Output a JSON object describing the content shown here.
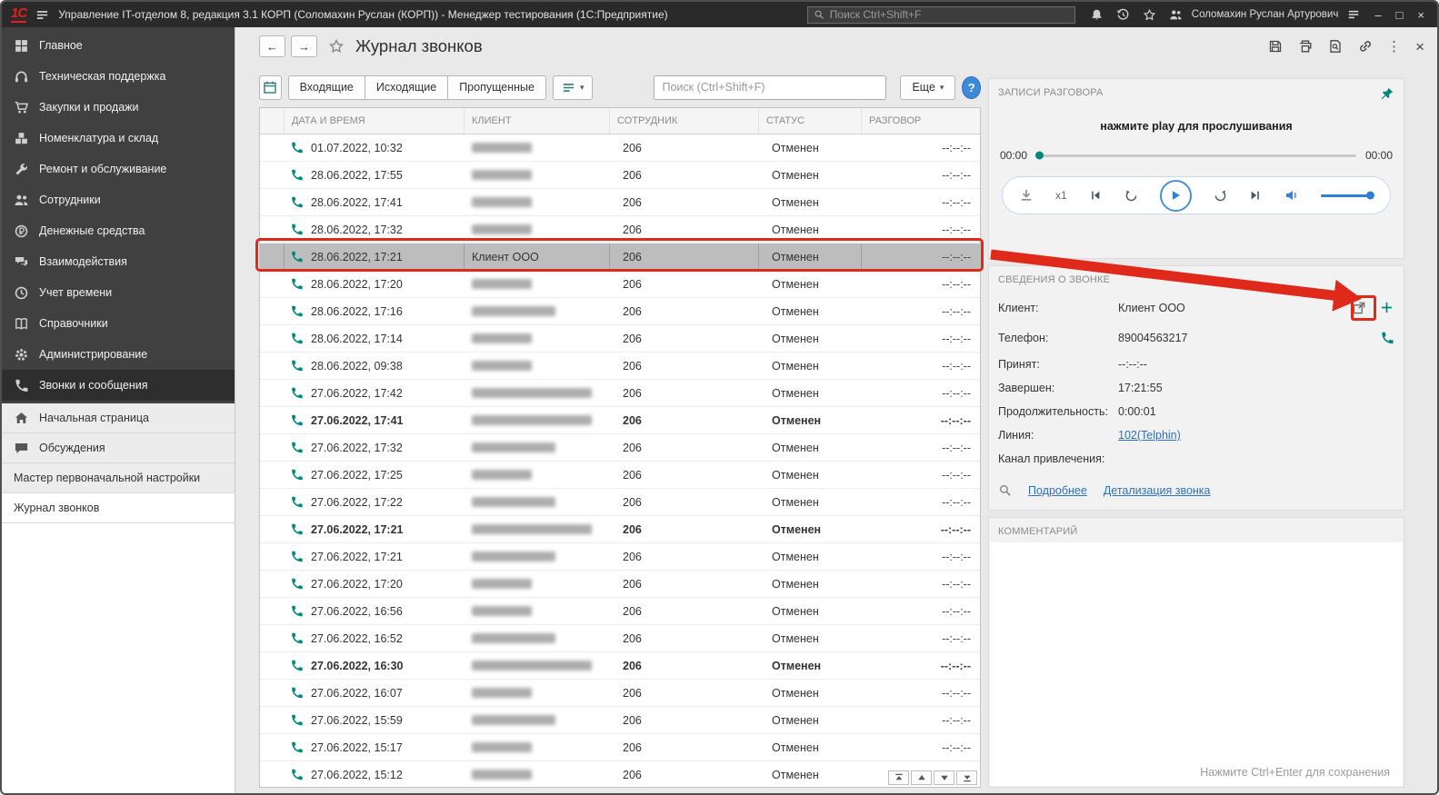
{
  "topbar": {
    "logo": "1С",
    "title": "Управление IT-отделом 8, редакция 3.1 КОРП (Соломахин Руслан (КОРП))  - Менеджер тестирования (1С:Предприятие)",
    "search_placeholder": "Поиск Ctrl+Shift+F",
    "user": "Соломахин Руслан Артурович",
    "window_controls": {
      "minimize": "–",
      "maximize": "□",
      "close": "×"
    }
  },
  "sidebar": {
    "main_items": [
      {
        "label": "Главное",
        "icon": "grid"
      },
      {
        "label": "Техническая поддержка",
        "icon": "headset"
      },
      {
        "label": "Закупки и продажи",
        "icon": "cart"
      },
      {
        "label": "Номенклатура и склад",
        "icon": "boxes"
      },
      {
        "label": "Ремонт и обслуживание",
        "icon": "wrench"
      },
      {
        "label": "Сотрудники",
        "icon": "users"
      },
      {
        "label": "Денежные средства",
        "icon": "money"
      },
      {
        "label": "Взаимодействия",
        "icon": "interact"
      },
      {
        "label": "Учет времени",
        "icon": "clock"
      },
      {
        "label": "Справочники",
        "icon": "book"
      },
      {
        "label": "Администрирование",
        "icon": "gear"
      },
      {
        "label": "Звонки и сообщения",
        "icon": "phone",
        "active": true
      }
    ],
    "bottom_items": [
      {
        "label": "Начальная страница",
        "icon": "home"
      },
      {
        "label": "Обсуждения",
        "icon": "chat"
      },
      {
        "label": "Мастер первоначальной настройки"
      },
      {
        "label": "Журнал звонков",
        "active": true
      }
    ]
  },
  "page": {
    "title": "Журнал звонков"
  },
  "toolbar": {
    "filters": [
      {
        "label": "Входящие"
      },
      {
        "label": "Исходящие"
      },
      {
        "label": "Пропущенные"
      }
    ],
    "search_placeholder": "Поиск (Ctrl+Shift+F)",
    "more_label": "Еще",
    "help_label": "?"
  },
  "table": {
    "columns": [
      "",
      "ДАТА И ВРЕМЯ",
      "КЛИЕНТ",
      "СОТРУДНИК",
      "СТАТУС",
      "РАЗГОВОР"
    ],
    "rows": [
      {
        "dt": "01.07.2022, 10:32",
        "emp": "206",
        "status": "Отменен",
        "talk": "--:--:--",
        "cw": 66
      },
      {
        "dt": "28.06.2022, 17:55",
        "emp": "206",
        "status": "Отменен",
        "talk": "--:--:--",
        "cw": 66
      },
      {
        "dt": "28.06.2022, 17:41",
        "emp": "206",
        "status": "Отменен",
        "talk": "--:--:--",
        "cw": 66
      },
      {
        "dt": "28.06.2022, 17:32",
        "emp": "206",
        "status": "Отменен",
        "talk": "--:--:--",
        "cw": 66
      },
      {
        "dt": "28.06.2022, 17:21",
        "client": "Клиент ООО",
        "emp": "206",
        "status": "Отменен",
        "talk": "--:--:--",
        "selected": true
      },
      {
        "dt": "28.06.2022, 17:20",
        "emp": "206",
        "status": "Отменен",
        "talk": "--:--:--",
        "cw": 66
      },
      {
        "dt": "28.06.2022, 17:16",
        "emp": "206",
        "status": "Отменен",
        "talk": "--:--:--",
        "cw": 92
      },
      {
        "dt": "28.06.2022, 17:14",
        "emp": "206",
        "status": "Отменен",
        "talk": "--:--:--",
        "cw": 66
      },
      {
        "dt": "28.06.2022, 09:38",
        "emp": "206",
        "status": "Отменен",
        "talk": "--:--:--",
        "cw": 66
      },
      {
        "dt": "27.06.2022, 17:42",
        "emp": "206",
        "status": "Отменен",
        "talk": "--:--:--",
        "cw": 132
      },
      {
        "dt": "27.06.2022, 17:41",
        "emp": "206",
        "status": "Отменен",
        "talk": "--:--:--",
        "cw": 132,
        "bold": true
      },
      {
        "dt": "27.06.2022, 17:32",
        "emp": "206",
        "status": "Отменен",
        "talk": "--:--:--",
        "cw": 92
      },
      {
        "dt": "27.06.2022, 17:25",
        "emp": "206",
        "status": "Отменен",
        "talk": "--:--:--",
        "cw": 66
      },
      {
        "dt": "27.06.2022, 17:22",
        "emp": "206",
        "status": "Отменен",
        "talk": "--:--:--",
        "cw": 92
      },
      {
        "dt": "27.06.2022, 17:21",
        "emp": "206",
        "status": "Отменен",
        "talk": "--:--:--",
        "cw": 132,
        "bold": true
      },
      {
        "dt": "27.06.2022, 17:21",
        "emp": "206",
        "status": "Отменен",
        "talk": "--:--:--",
        "cw": 92
      },
      {
        "dt": "27.06.2022, 17:20",
        "emp": "206",
        "status": "Отменен",
        "talk": "--:--:--",
        "cw": 66
      },
      {
        "dt": "27.06.2022, 16:56",
        "emp": "206",
        "status": "Отменен",
        "talk": "--:--:--",
        "cw": 66
      },
      {
        "dt": "27.06.2022, 16:52",
        "emp": "206",
        "status": "Отменен",
        "talk": "--:--:--",
        "cw": 92
      },
      {
        "dt": "27.06.2022, 16:30",
        "emp": "206",
        "status": "Отменен",
        "talk": "--:--:--",
        "cw": 132,
        "bold": true
      },
      {
        "dt": "27.06.2022, 16:07",
        "emp": "206",
        "status": "Отменен",
        "talk": "--:--:--",
        "cw": 66
      },
      {
        "dt": "27.06.2022, 15:59",
        "emp": "206",
        "status": "Отменен",
        "talk": "--:--:--",
        "cw": 92
      },
      {
        "dt": "27.06.2022, 15:17",
        "emp": "206",
        "status": "Отменен",
        "talk": "--:--:--",
        "cw": 66
      },
      {
        "dt": "27.06.2022, 15:12",
        "emp": "206",
        "status": "Отменен",
        "talk": "--:--:--",
        "cw": 66
      }
    ]
  },
  "records": {
    "title": "ЗАПИСИ РАЗГОВОРА",
    "hint": "нажмите play для прослушивания",
    "time_current": "00:00",
    "time_total": "00:00",
    "speed": "x1"
  },
  "details": {
    "title": "СВЕДЕНИЯ О ЗВОНКЕ",
    "fields": [
      {
        "label": "Клиент:",
        "value": "Клиент ООО"
      },
      {
        "label": "Телефон:",
        "value": "89004563217"
      },
      {
        "label": "Принят:",
        "value": "--:--:--"
      },
      {
        "label": "Завершен:",
        "value": "17:21:55"
      },
      {
        "label": "Продолжительность:",
        "value": "0:00:01"
      },
      {
        "label": "Линия:",
        "value": "102(Telphin)"
      },
      {
        "label": "Канал привлечения:",
        "value": ""
      }
    ],
    "links": [
      {
        "label": "Подробнее"
      },
      {
        "label": "Детализация звонка"
      }
    ]
  },
  "comment": {
    "title": "КОММЕНТАРИЙ",
    "save_hint": "Нажмите Ctrl+Enter для сохранения"
  },
  "colors": {
    "accent_teal": "#00897b",
    "accent_blue": "#2f7fd6",
    "annotation_red": "#df2a1b",
    "brand_red": "#e31e24"
  }
}
